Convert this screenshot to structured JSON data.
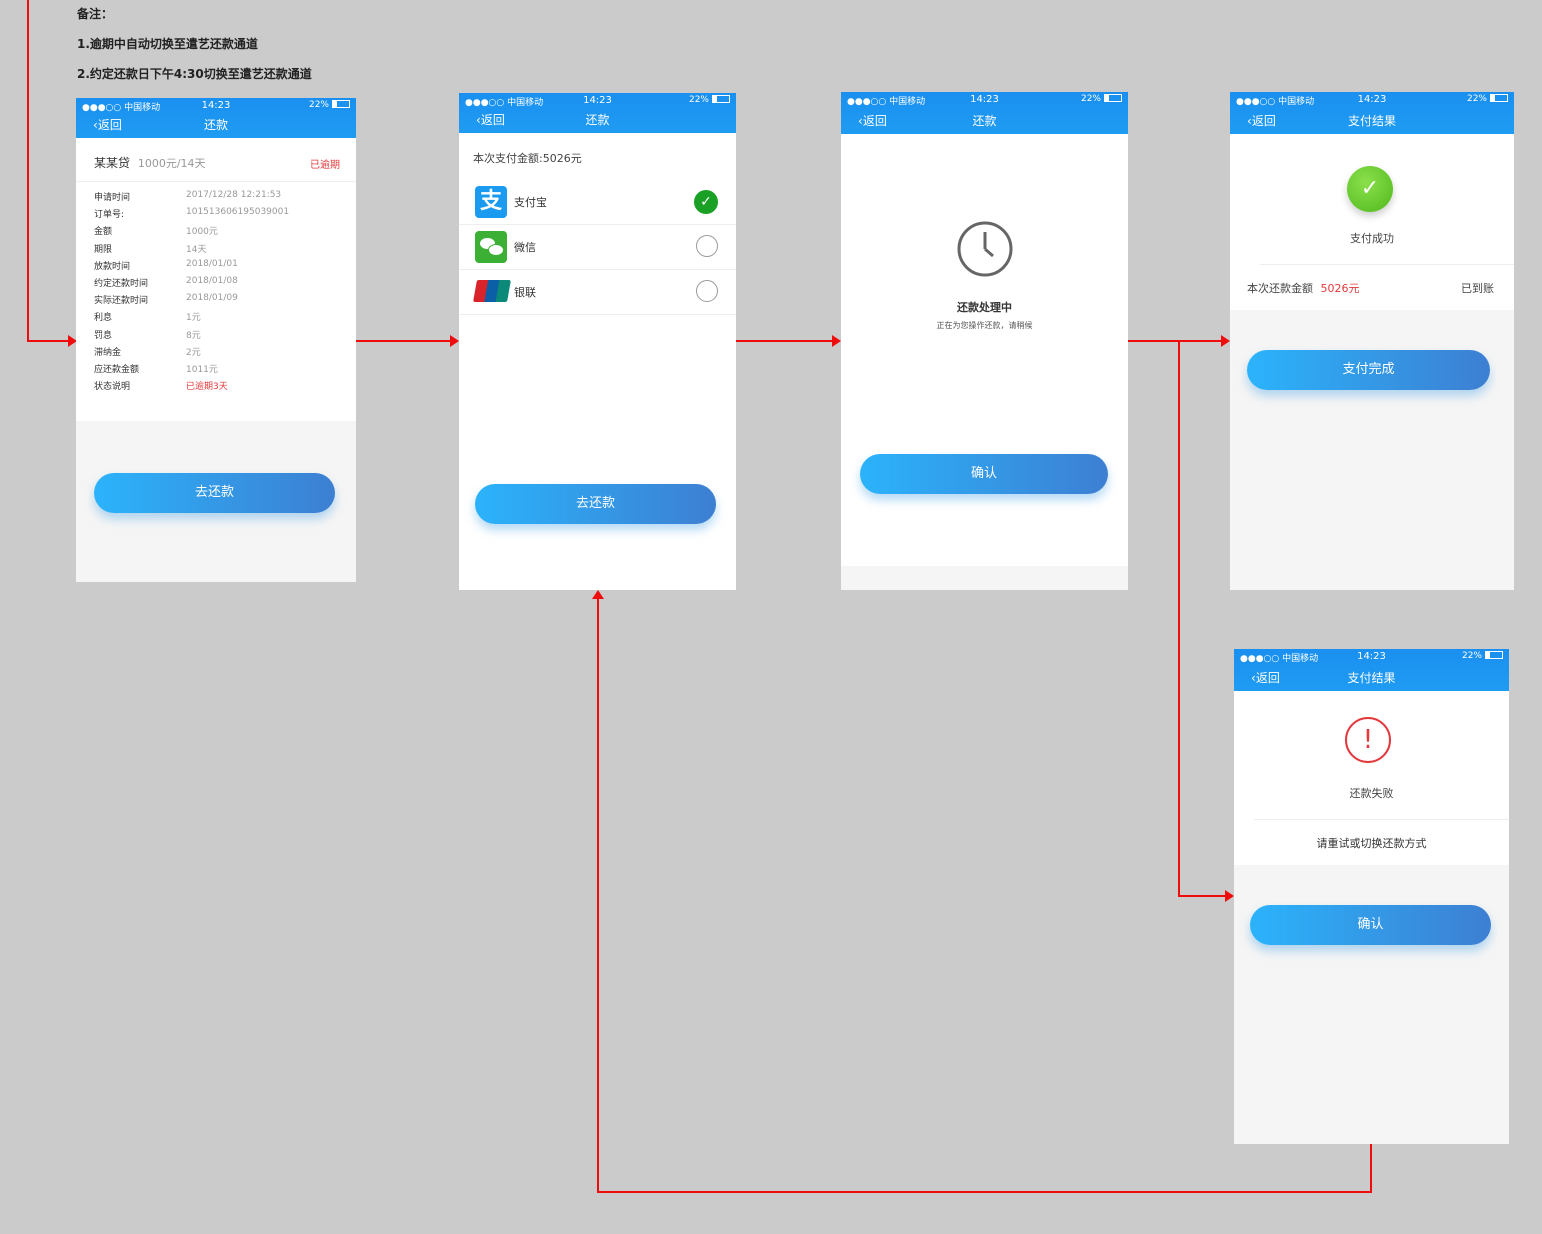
{
  "notes": {
    "title": "备注：",
    "line1": "1.逾期中自动切换至遣艺还款通道",
    "line2": "2.约定还款日下午4:30切换至遣艺还款通道"
  },
  "status_bar": {
    "signal": "●●●○○ 中国移动",
    "time": "14:23",
    "battery": "22%"
  },
  "nav": {
    "back": "返回"
  },
  "screen1": {
    "title": "还款",
    "loan_name": "某某贷",
    "loan_amount": "1000元/14天",
    "overdue_badge": "已逾期",
    "rows": [
      {
        "label": "申请时间",
        "value": "2017/12/28  12:21:53"
      },
      {
        "label": "订单号:",
        "value": "101513606195039001"
      },
      {
        "label": "金额",
        "value": "1000元"
      },
      {
        "label": "期限",
        "value": "14天"
      },
      {
        "label": "放款时间",
        "value": "2018/01/01"
      },
      {
        "label": "约定还款时间",
        "value": "2018/01/08"
      },
      {
        "label": "实际还款时间",
        "value": "2018/01/09"
      },
      {
        "label": "利息",
        "value": "1元"
      },
      {
        "label": "罚息",
        "value": "8元"
      },
      {
        "label": "滞纳金",
        "value": "2元"
      },
      {
        "label": "应还款金额",
        "value": "1011元"
      },
      {
        "label": "状态说明",
        "value": "已逾期3天"
      }
    ],
    "button": "去还款"
  },
  "screen2": {
    "title": "还款",
    "amount_text": "本次支付金额:5026元",
    "methods": [
      {
        "label": "支付宝",
        "selected": true
      },
      {
        "label": "微信",
        "selected": false
      },
      {
        "label": "银联",
        "selected": false
      }
    ],
    "button": "去还款"
  },
  "screen3": {
    "title": "还款",
    "status": "还款处理中",
    "subtitle": "正在为您操作还款，请稍候",
    "button": "确认"
  },
  "screen4": {
    "title": "支付结果",
    "status": "支付成功",
    "amount_label": "本次还款金额",
    "amount": "5026元",
    "state": "已到账",
    "button": "支付完成"
  },
  "screen5": {
    "title": "支付结果",
    "status": "还款失败",
    "hint": "请重试或切换还款方式",
    "button": "确认"
  },
  "colors": {
    "accent": "#1f9cf2",
    "danger": "#e4393c",
    "success": "#5cc52c",
    "flow_line": "#ef0c0c"
  }
}
